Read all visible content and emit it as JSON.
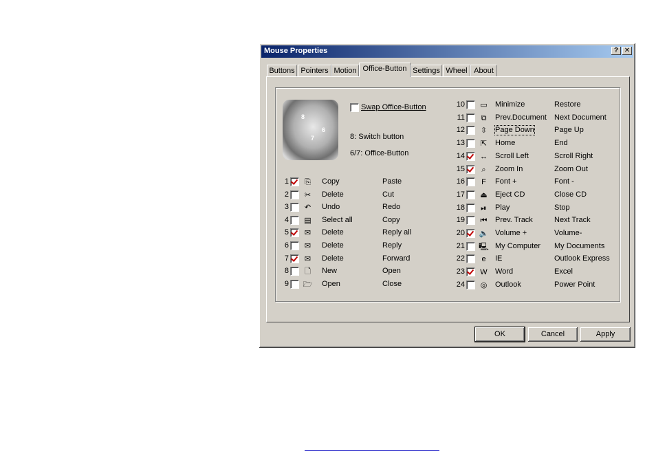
{
  "window": {
    "title": "Mouse Properties",
    "help_glyph": "?",
    "close_glyph": "✕"
  },
  "tabs": [
    {
      "label": "Buttons"
    },
    {
      "label": "Pointers"
    },
    {
      "label": "Motion"
    },
    {
      "label": "Office-Button",
      "active": true
    },
    {
      "label": "Settings"
    },
    {
      "label": "Wheel"
    },
    {
      "label": "About"
    }
  ],
  "swap": {
    "label": "Swap Office-Button",
    "checked": false
  },
  "info": {
    "switch_button": "8: Switch button",
    "office_button": "6/7: Office-Button"
  },
  "mouse_labels": {
    "eight": "8",
    "six": "6",
    "seven": "7"
  },
  "left_rows": [
    {
      "num": "1",
      "checked": true,
      "icon": "copy-icon",
      "glyph": "⎘",
      "primary": "Copy",
      "secondary": "Paste"
    },
    {
      "num": "2",
      "checked": false,
      "icon": "scissors-icon",
      "glyph": "✂",
      "primary": "Delete",
      "secondary": "Cut"
    },
    {
      "num": "3",
      "checked": false,
      "icon": "undo-icon",
      "glyph": "↶",
      "primary": "Undo",
      "secondary": "Redo"
    },
    {
      "num": "4",
      "checked": false,
      "icon": "select-all-icon",
      "glyph": "▤",
      "primary": "Select all",
      "secondary": "Copy"
    },
    {
      "num": "5",
      "checked": true,
      "icon": "mail-delete-icon",
      "glyph": "✉",
      "primary": "Delete",
      "secondary": "Reply all"
    },
    {
      "num": "6",
      "checked": false,
      "icon": "mail-reply-icon",
      "glyph": "✉",
      "primary": "Delete",
      "secondary": "Reply"
    },
    {
      "num": "7",
      "checked": true,
      "icon": "mail-forward-icon",
      "glyph": "✉",
      "primary": "Delete",
      "secondary": "Forward"
    },
    {
      "num": "8",
      "checked": false,
      "icon": "new-document-icon",
      "glyph": "🗋",
      "primary": "New",
      "secondary": "Open"
    },
    {
      "num": "9",
      "checked": false,
      "icon": "open-folder-icon",
      "glyph": "🗁",
      "primary": "Open",
      "secondary": "Close"
    }
  ],
  "right_rows": [
    {
      "num": "10",
      "checked": false,
      "icon": "window-icon",
      "glyph": "▭",
      "primary": "Minimize",
      "secondary": "Restore"
    },
    {
      "num": "11",
      "checked": false,
      "icon": "documents-icon",
      "glyph": "⧉",
      "primary": "Prev.Document",
      "secondary": "Next Document"
    },
    {
      "num": "12",
      "checked": false,
      "icon": "page-icon",
      "glyph": "⇳",
      "primary": "Page Down",
      "secondary": "Page Up",
      "focus": true
    },
    {
      "num": "13",
      "checked": false,
      "icon": "home-end-icon",
      "glyph": "⇱",
      "primary": "Home",
      "secondary": "End"
    },
    {
      "num": "14",
      "checked": true,
      "icon": "scroll-icon",
      "glyph": "↔",
      "primary": "Scroll Left",
      "secondary": "Scroll Right"
    },
    {
      "num": "15",
      "checked": true,
      "icon": "zoom-icon",
      "glyph": "⌕",
      "primary": "Zoom In",
      "secondary": "Zoom Out"
    },
    {
      "num": "16",
      "checked": false,
      "icon": "font-size-icon",
      "glyph": "F",
      "primary": "Font +",
      "secondary": "Font -"
    },
    {
      "num": "17",
      "checked": false,
      "icon": "eject-icon",
      "glyph": "⏏",
      "primary": "Eject CD",
      "secondary": "Close CD"
    },
    {
      "num": "18",
      "checked": false,
      "icon": "play-pause-icon",
      "glyph": "⏯",
      "primary": "Play",
      "secondary": "Stop"
    },
    {
      "num": "19",
      "checked": false,
      "icon": "previous-track-icon",
      "glyph": "⏮",
      "primary": "Prev. Track",
      "secondary": "Next Track"
    },
    {
      "num": "20",
      "checked": true,
      "icon": "volume-icon",
      "glyph": "🔈",
      "primary": "Volume +",
      "secondary": "Volume-"
    },
    {
      "num": "21",
      "checked": false,
      "icon": "computer-icon",
      "glyph": "🖳",
      "primary": "My Computer",
      "secondary": "My Documents"
    },
    {
      "num": "22",
      "checked": false,
      "icon": "internet-explorer-icon",
      "glyph": "e",
      "primary": "IE",
      "secondary": "Outlook Express"
    },
    {
      "num": "23",
      "checked": true,
      "icon": "word-icon",
      "glyph": "W",
      "primary": "Word",
      "secondary": "Excel"
    },
    {
      "num": "24",
      "checked": false,
      "icon": "outlook-icon",
      "glyph": "◎",
      "primary": "Outlook",
      "secondary": "Power Point"
    }
  ],
  "buttons": {
    "ok": "OK",
    "cancel": "Cancel",
    "apply": "Apply"
  },
  "colors": {
    "title_start": "#0a246a",
    "title_end": "#a6caf0",
    "check_mark": "#c00000",
    "face": "#d4d0c8"
  }
}
